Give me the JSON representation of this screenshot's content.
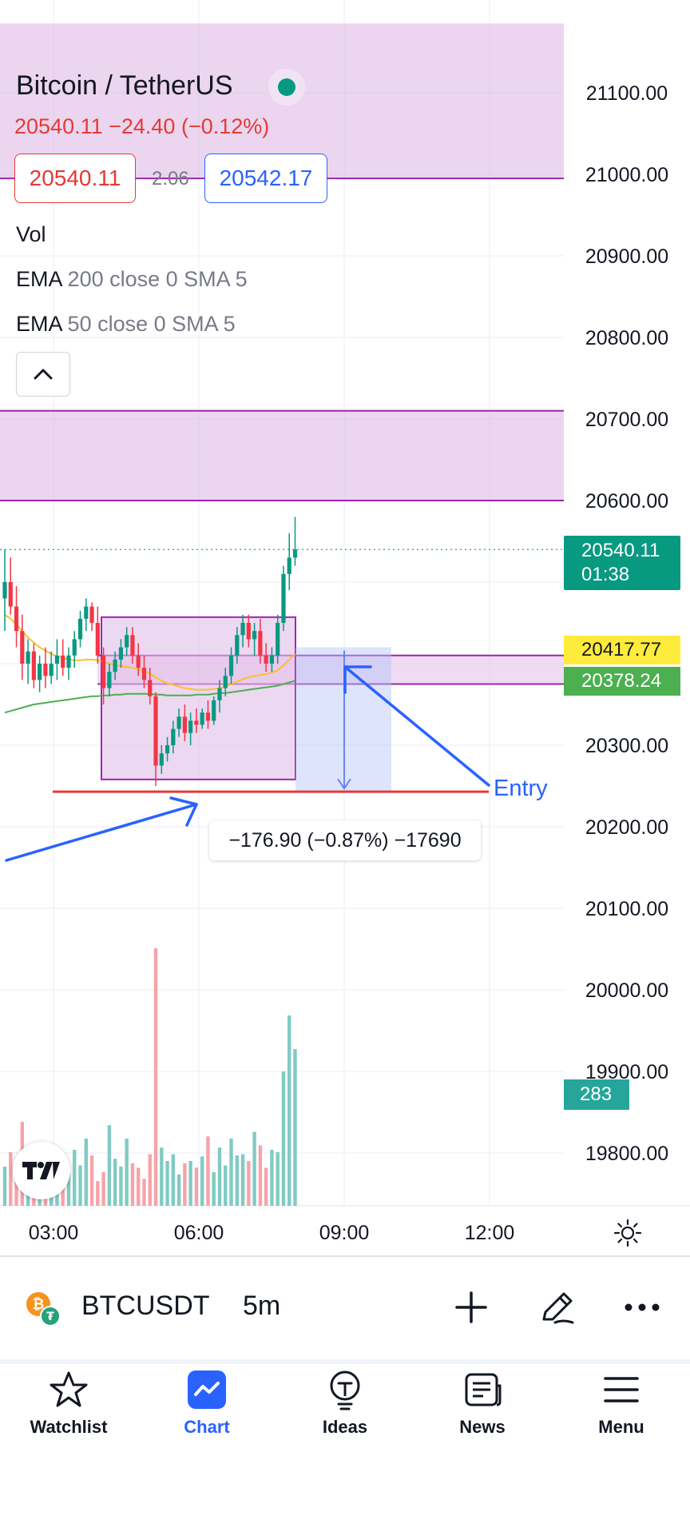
{
  "symbol": {
    "title": "Bitcoin / TetherUS",
    "quote": "20540.11  −24.40 (−0.12%)",
    "bid": "20540.11",
    "spread": "2.06",
    "ask": "20542.17",
    "ticker": "BTCUSDT",
    "timeframe": "5m"
  },
  "indicators": {
    "vol": "Vol",
    "ema200_name": "EMA",
    "ema200_params": "200 close 0 SMA 5",
    "ema50_name": "EMA",
    "ema50_params": "50 close 0 SMA 5"
  },
  "price_axis": {
    "labels": [
      "21100.00",
      "21000.00",
      "20900.00",
      "20800.00",
      "20700.00",
      "20600.00",
      "20300.00",
      "20200.00",
      "20100.00",
      "20000.00",
      "19900.00",
      "19800.00"
    ],
    "last_price": "20540.11",
    "countdown": "01:38",
    "ema50_value": "20417.77",
    "ema200_value": "20378.24",
    "volume_value": "283"
  },
  "time_axis": {
    "labels": [
      "03:00",
      "06:00",
      "09:00",
      "12:00"
    ]
  },
  "drawings": {
    "measure_label": "−176.90 (−0.87%) −17690",
    "entry_label": "Entry"
  },
  "nav": {
    "watchlist": "Watchlist",
    "chart": "Chart",
    "ideas": "Ideas",
    "news": "News",
    "menu": "Menu"
  },
  "colors": {
    "up": "#089981",
    "down": "#f23645",
    "zone_fill": "#e1bee7",
    "zone_border": "#9c27b0",
    "annotation_blue": "#2962ff",
    "ema50": "#fbc02d",
    "ema200": "#4caf50",
    "last_price_tag": "#089981"
  },
  "chart_data": {
    "type": "candlestick",
    "timeframe": "5m",
    "x_ticks": [
      "03:00",
      "06:00",
      "09:00",
      "12:00"
    ],
    "y_range": [
      19750,
      21150
    ],
    "candles": [
      {
        "o": 20480,
        "h": 20540,
        "l": 20440,
        "c": 20500
      },
      {
        "o": 20500,
        "h": 20530,
        "l": 20460,
        "c": 20470
      },
      {
        "o": 20470,
        "h": 20495,
        "l": 20420,
        "c": 20440
      },
      {
        "o": 20440,
        "h": 20460,
        "l": 20380,
        "c": 20400
      },
      {
        "o": 20400,
        "h": 20430,
        "l": 20375,
        "c": 20415
      },
      {
        "o": 20415,
        "h": 20425,
        "l": 20370,
        "c": 20380
      },
      {
        "o": 20380,
        "h": 20410,
        "l": 20365,
        "c": 20400
      },
      {
        "o": 20400,
        "h": 20420,
        "l": 20370,
        "c": 20385
      },
      {
        "o": 20385,
        "h": 20415,
        "l": 20375,
        "c": 20400
      },
      {
        "o": 20400,
        "h": 20430,
        "l": 20380,
        "c": 20410
      },
      {
        "o": 20410,
        "h": 20430,
        "l": 20385,
        "c": 20395
      },
      {
        "o": 20395,
        "h": 20420,
        "l": 20380,
        "c": 20410
      },
      {
        "o": 20410,
        "h": 20440,
        "l": 20395,
        "c": 20430
      },
      {
        "o": 20430,
        "h": 20465,
        "l": 20420,
        "c": 20455
      },
      {
        "o": 20455,
        "h": 20480,
        "l": 20440,
        "c": 20470
      },
      {
        "o": 20470,
        "h": 20475,
        "l": 20440,
        "c": 20450
      },
      {
        "o": 20450,
        "h": 20470,
        "l": 20400,
        "c": 20410
      },
      {
        "o": 20410,
        "h": 20420,
        "l": 20350,
        "c": 20370
      },
      {
        "o": 20370,
        "h": 20400,
        "l": 20360,
        "c": 20390
      },
      {
        "o": 20390,
        "h": 20415,
        "l": 20380,
        "c": 20405
      },
      {
        "o": 20405,
        "h": 20430,
        "l": 20395,
        "c": 20420
      },
      {
        "o": 20420,
        "h": 20445,
        "l": 20410,
        "c": 20435
      },
      {
        "o": 20435,
        "h": 20445,
        "l": 20400,
        "c": 20410
      },
      {
        "o": 20410,
        "h": 20425,
        "l": 20385,
        "c": 20395
      },
      {
        "o": 20395,
        "h": 20410,
        "l": 20370,
        "c": 20380
      },
      {
        "o": 20380,
        "h": 20395,
        "l": 20350,
        "c": 20360
      },
      {
        "o": 20360,
        "h": 20365,
        "l": 20250,
        "c": 20275
      },
      {
        "o": 20275,
        "h": 20300,
        "l": 20265,
        "c": 20290
      },
      {
        "o": 20290,
        "h": 20310,
        "l": 20280,
        "c": 20300
      },
      {
        "o": 20300,
        "h": 20330,
        "l": 20290,
        "c": 20320
      },
      {
        "o": 20320,
        "h": 20345,
        "l": 20310,
        "c": 20335
      },
      {
        "o": 20335,
        "h": 20350,
        "l": 20305,
        "c": 20315
      },
      {
        "o": 20315,
        "h": 20340,
        "l": 20300,
        "c": 20330
      },
      {
        "o": 20330,
        "h": 20345,
        "l": 20315,
        "c": 20325
      },
      {
        "o": 20325,
        "h": 20345,
        "l": 20320,
        "c": 20340
      },
      {
        "o": 20340,
        "h": 20355,
        "l": 20320,
        "c": 20330
      },
      {
        "o": 20330,
        "h": 20360,
        "l": 20325,
        "c": 20355
      },
      {
        "o": 20355,
        "h": 20380,
        "l": 20340,
        "c": 20370
      },
      {
        "o": 20370,
        "h": 20395,
        "l": 20360,
        "c": 20385
      },
      {
        "o": 20385,
        "h": 20420,
        "l": 20375,
        "c": 20410
      },
      {
        "o": 20410,
        "h": 20445,
        "l": 20400,
        "c": 20435
      },
      {
        "o": 20435,
        "h": 20460,
        "l": 20420,
        "c": 20450
      },
      {
        "o": 20450,
        "h": 20460,
        "l": 20420,
        "c": 20430
      },
      {
        "o": 20430,
        "h": 20450,
        "l": 20410,
        "c": 20440
      },
      {
        "o": 20440,
        "h": 20455,
        "l": 20400,
        "c": 20410
      },
      {
        "o": 20410,
        "h": 20425,
        "l": 20390,
        "c": 20400
      },
      {
        "o": 20400,
        "h": 20420,
        "l": 20390,
        "c": 20410
      },
      {
        "o": 20410,
        "h": 20460,
        "l": 20400,
        "c": 20450
      },
      {
        "o": 20450,
        "h": 20520,
        "l": 20440,
        "c": 20510
      },
      {
        "o": 20510,
        "h": 20560,
        "l": 20490,
        "c": 20530
      },
      {
        "o": 20530,
        "h": 20580,
        "l": 20520,
        "c": 20540
      }
    ],
    "volume": [
      35,
      48,
      40,
      75,
      30,
      55,
      28,
      38,
      32,
      26,
      40,
      29,
      50,
      36,
      60,
      45,
      22,
      30,
      72,
      42,
      35,
      60,
      38,
      34,
      24,
      46,
      230,
      52,
      40,
      46,
      28,
      38,
      40,
      34,
      44,
      62,
      30,
      52,
      36,
      60,
      45,
      46,
      40,
      66,
      54,
      34,
      50,
      48,
      120,
      170,
      140
    ],
    "ema50": [
      20460,
      20455,
      20448,
      20440,
      20432,
      20426,
      20420,
      20416,
      20412,
      20409,
      20407,
      20405,
      20404,
      20404,
      20405,
      20405,
      20404,
      20402,
      20400,
      20398,
      20397,
      20396,
      20395,
      20393,
      20391,
      20388,
      20383,
      20379,
      20376,
      20374,
      20372,
      20370,
      20369,
      20368,
      20368,
      20368,
      20369,
      20370,
      20372,
      20375,
      20378,
      20381,
      20383,
      20385,
      20386,
      20387,
      20389,
      20392,
      20398,
      20405,
      20412
    ],
    "ema200": [
      20340,
      20342,
      20344,
      20346,
      20348,
      20350,
      20351,
      20352,
      20353,
      20354,
      20355,
      20356,
      20357,
      20358,
      20359,
      20360,
      20360,
      20361,
      20361,
      20362,
      20362,
      20363,
      20363,
      20363,
      20363,
      20363,
      20362,
      20362,
      20361,
      20361,
      20361,
      20361,
      20361,
      20362,
      20362,
      20362,
      20363,
      20364,
      20364,
      20365,
      20366,
      20367,
      20368,
      20369,
      20370,
      20371,
      20372,
      20373,
      20375,
      20377,
      20379
    ],
    "zones": [
      {
        "from": 20995,
        "to": 21185
      },
      {
        "from": 20600,
        "to": 20710
      },
      {
        "from": 20375,
        "to": 20410
      }
    ],
    "stop_line": 20243,
    "measure": {
      "from": 20420,
      "to": 20243,
      "change": -176.9,
      "percent": -0.87,
      "ticks": -17690
    }
  }
}
